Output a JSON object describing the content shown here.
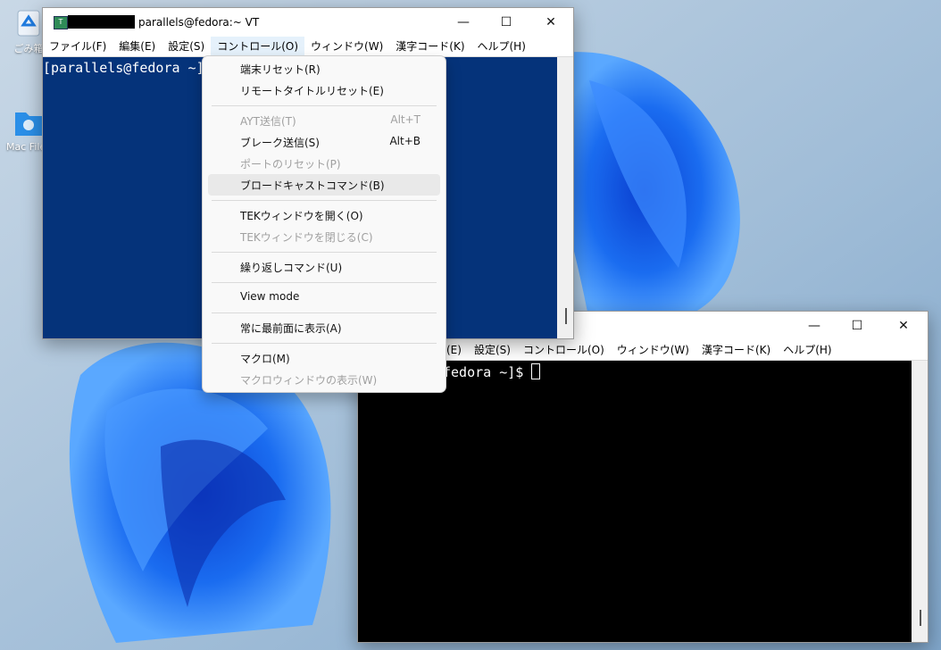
{
  "desktop": {
    "icons": [
      {
        "label": "ごみ箱",
        "icon": "recycle-bin-icon"
      },
      {
        "label": "Mac Files",
        "icon": "folder-icon"
      }
    ]
  },
  "window1": {
    "title": "parallels@fedora:~ VT",
    "icon": "teraterm-icon",
    "menu": [
      "ファイル(F)",
      "編集(E)",
      "設定(S)",
      "コントロール(O)",
      "ウィンドウ(W)",
      "漢字コード(K)",
      "ヘルプ(H)"
    ],
    "prompt": "[parallels@fedora ~]$",
    "colors": {
      "terminal_bg": "#05337a",
      "terminal_fg": "#ffffff"
    }
  },
  "window2": {
    "menu": [
      "(E)",
      "設定(S)",
      "コントロール(O)",
      "ウィンドウ(W)",
      "漢字コード(K)",
      "ヘルプ(H)"
    ],
    "prompt": "fedora ~]$",
    "colors": {
      "terminal_bg": "#000000",
      "terminal_fg": "#ffffff"
    }
  },
  "control_menu": {
    "items": [
      {
        "label": "端末リセット(R)",
        "shortcut": "",
        "disabled": false
      },
      {
        "label": "リモートタイトルリセット(E)",
        "shortcut": "",
        "disabled": false
      },
      {
        "label": "AYT送信(T)",
        "shortcut": "Alt+T",
        "disabled": true
      },
      {
        "label": "ブレーク送信(S)",
        "shortcut": "Alt+B",
        "disabled": false
      },
      {
        "label": "ポートのリセット(P)",
        "shortcut": "",
        "disabled": true
      },
      {
        "label": "ブロードキャストコマンド(B)",
        "shortcut": "",
        "disabled": false,
        "highlighted": true
      },
      {
        "label": "TEKウィンドウを開く(O)",
        "shortcut": "",
        "disabled": false
      },
      {
        "label": "TEKウィンドウを閉じる(C)",
        "shortcut": "",
        "disabled": true
      },
      {
        "label": "繰り返しコマンド(U)",
        "shortcut": "",
        "disabled": false
      },
      {
        "label": "View mode",
        "shortcut": "",
        "disabled": false
      },
      {
        "label": "常に最前面に表示(A)",
        "shortcut": "",
        "disabled": false
      },
      {
        "label": "マクロ(M)",
        "shortcut": "",
        "disabled": false
      },
      {
        "label": "マクロウィンドウの表示(W)",
        "shortcut": "",
        "disabled": true
      }
    ]
  }
}
